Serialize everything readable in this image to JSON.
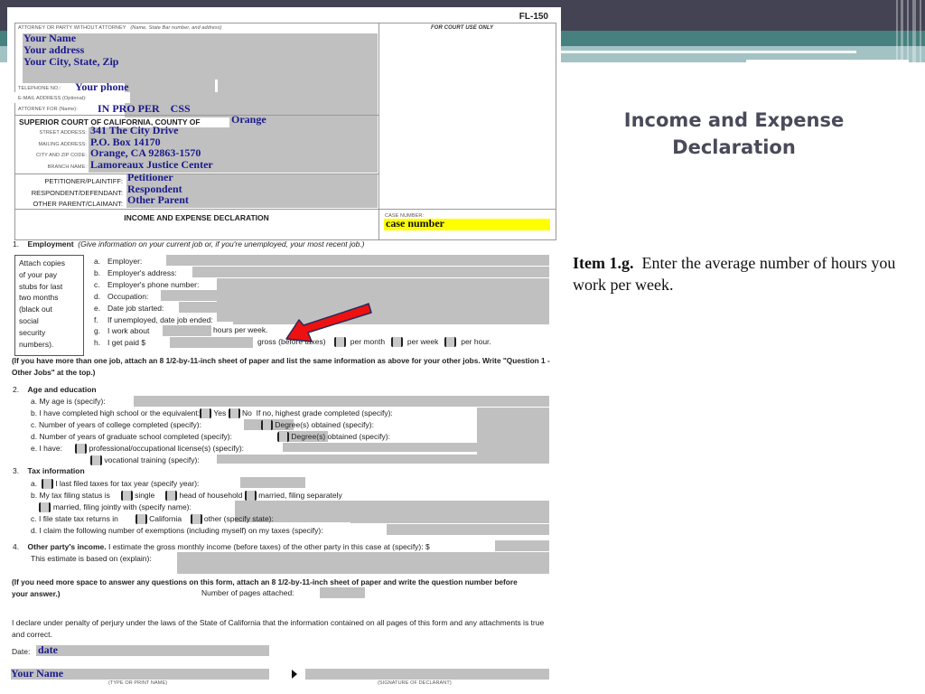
{
  "slide": {
    "title_line1": "Income and Expense",
    "title_line2": "Declaration",
    "instruction_bold": "Item 1.g.",
    "instruction_text": "Enter the average number of hours you work per week."
  },
  "form": {
    "form_id": "FL-150",
    "header": {
      "attorney_label": "ATTORNEY OR PARTY WITHOUT ATTORNEY",
      "attorney_hint": "(Name, State Bar number, and address)",
      "name": "Your Name",
      "address": "Your address",
      "city_state_zip": "Your City, State, Zip",
      "telephone_label": "TELEPHONE NO.:",
      "telephone": "Your phone",
      "email_label": "E-MAIL ADDRESS (Optional):",
      "attorney_for_label": "ATTORNEY FOR (Name):",
      "attorney_for": "IN PRO PER    CSS",
      "court_label": "SUPERIOR COURT OF CALIFORNIA, COUNTY OF",
      "county": "Orange",
      "street_label": "STREET ADDRESS:",
      "street": "341 The City Drive",
      "mailing_label": "MAILING ADDRESS:",
      "mailing": "P.O. Box 14170",
      "city_zip_label": "CITY AND ZIP CODE:",
      "city_zip": "Orange, CA 92863-1570",
      "branch_label": "BRANCH NAME:",
      "branch": "Lamoreaux Justice Center",
      "petitioner_label": "PETITIONER/PLAINTIFF:",
      "petitioner": "Petitioner",
      "respondent_label": "RESPONDENT/DEFENDANT:",
      "respondent": "Respondent",
      "other_parent_label": "OTHER PARENT/CLAIMANT:",
      "other_parent": "Other Parent",
      "court_use_label": "FOR COURT USE ONLY",
      "form_title": "INCOME AND EXPENSE DECLARATION",
      "case_number_label": "CASE NUMBER:",
      "case_number": "case number"
    },
    "section1": {
      "num": "1.",
      "title": "Employment",
      "hint": "(Give information on your current job or, if you're unemployed, your most recent job.)",
      "attach_note": [
        "Attach copies",
        "of your pay",
        "stubs for last",
        "two months",
        "(black out",
        "social",
        "security",
        "numbers)."
      ],
      "items": [
        {
          "letter": "a.",
          "label": "Employer:"
        },
        {
          "letter": "b.",
          "label": "Employer's address:"
        },
        {
          "letter": "c.",
          "label": "Employer's phone number:"
        },
        {
          "letter": "d.",
          "label": "Occupation:"
        },
        {
          "letter": "e.",
          "label": "Date job started:"
        },
        {
          "letter": "f.",
          "label": "If unemployed, date job ended:"
        },
        {
          "letter": "g.",
          "label": "I work about",
          "suffix": "hours per week."
        },
        {
          "letter": "h.",
          "label": "I get paid $",
          "suffix": "gross (before taxes)"
        }
      ],
      "pay_options": [
        "per month",
        "per week",
        "per hour."
      ],
      "note": "(If you have more than one job, attach an 8 1/2-by-11-inch sheet of paper and list the same information as above for your other jobs. Write \"Question 1 - Other Jobs\" at the top.)"
    },
    "section2": {
      "num": "2.",
      "title": "Age and education",
      "a": "a.  My age is (specify):",
      "b": "b.  I have completed high school or the equivalent:",
      "b_yes": "Yes",
      "b_no": "No",
      "b_tail": "If no, highest grade completed (specify):",
      "c": "c.  Number of years of college completed (specify):",
      "c_degree": "Degree(s) obtained (specify):",
      "d": "d.  Number of years of graduate school completed (specify):",
      "d_degree": "Degree(s) obtained (specify):",
      "e": "e.  I have:",
      "e_license": "professional/occupational license(s) (specify):",
      "e_vocational": "vocational training (specify):"
    },
    "section3": {
      "num": "3.",
      "title": "Tax information",
      "a": "I last filed taxes for tax year (specify year):",
      "b": "b.  My tax filing status is",
      "b_single": "single",
      "b_head": "head of household",
      "b_sep": "married, filing separately",
      "b_joint": "married, filing jointly with (specify name):",
      "c": "c.  I file state tax returns in",
      "c_ca": "California",
      "c_other": "other (specify state):",
      "d": "d.  I claim the following number of exemptions (including myself) on my taxes (specify):"
    },
    "section4": {
      "num": "4.",
      "title": "Other party's income.",
      "text": "I estimate the gross monthly income (before taxes) of the other party in this case at (specify): $",
      "basis": "This estimate is based on (explain):"
    },
    "more_space_note": "(If you need more space to answer any questions on this form, attach an 8 1/2-by-11-inch sheet of paper and write the question number before your answer.)",
    "pages_attached_label": "Number of pages attached:",
    "declaration": "I declare under penalty of perjury under the laws of the State of California that the information contained on all pages of this form and any attachments is true and correct.",
    "date_label": "Date:",
    "date": "date",
    "signer_name": "Your Name",
    "type_name_caption": "(TYPE OR PRINT NAME)",
    "signature_caption": "(SIGNATURE OF DECLARANT)"
  },
  "colors": {
    "band_dark": "#434354",
    "band_teal": "#46807f",
    "band_light": "#a3c2c4",
    "fill_text": "#1a1a8c",
    "case_highlight": "#ffff00",
    "arrow": "#ee1111"
  }
}
